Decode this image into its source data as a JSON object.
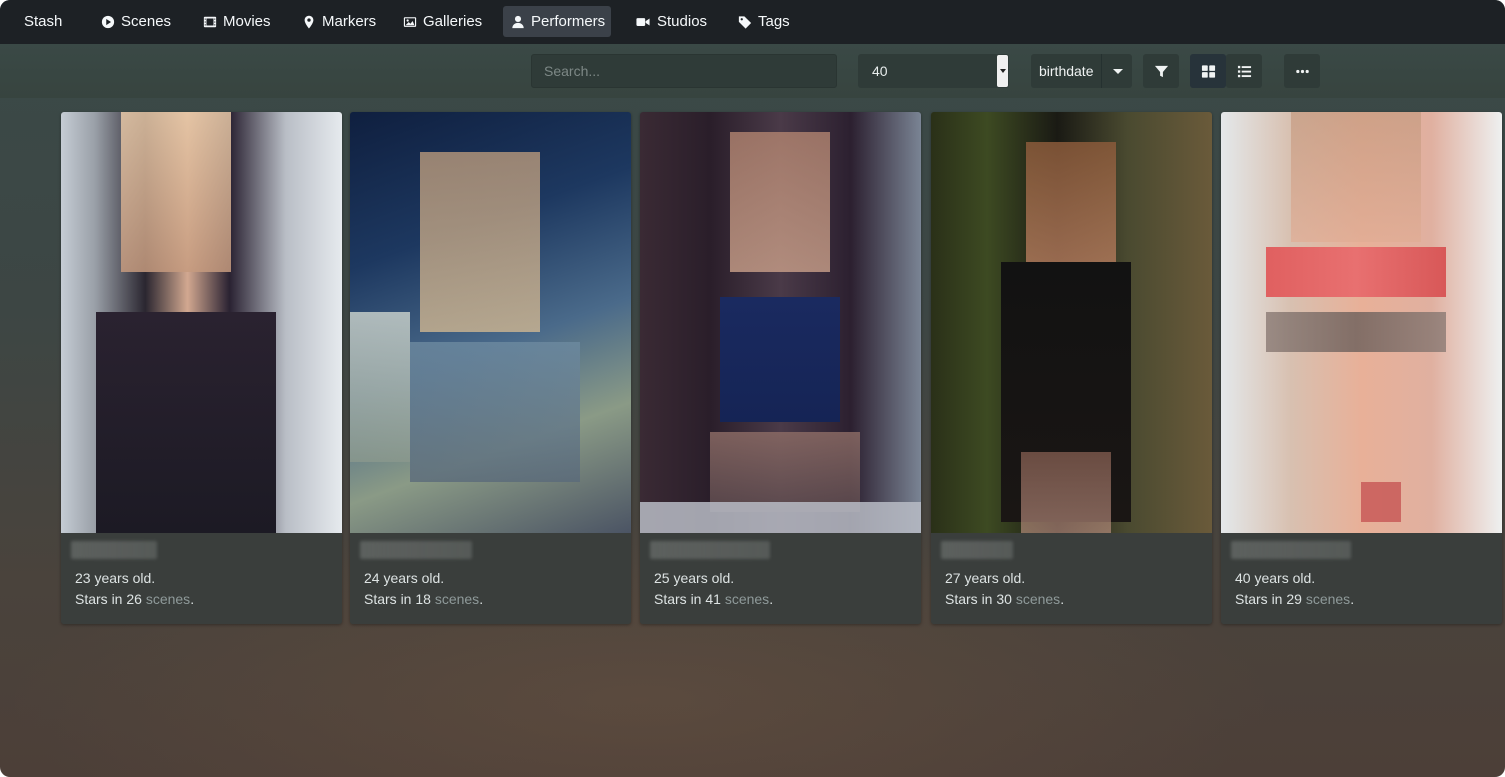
{
  "app": {
    "brand": "Stash"
  },
  "nav": {
    "items": [
      {
        "label": "Scenes",
        "icon": "play-circle-icon",
        "active": false
      },
      {
        "label": "Movies",
        "icon": "film-icon",
        "active": false
      },
      {
        "label": "Markers",
        "icon": "map-marker-icon",
        "active": false
      },
      {
        "label": "Galleries",
        "icon": "image-icon",
        "active": false
      },
      {
        "label": "Performers",
        "icon": "user-icon",
        "active": true
      },
      {
        "label": "Studios",
        "icon": "video-camera-icon",
        "active": false
      },
      {
        "label": "Tags",
        "icon": "tag-icon",
        "active": false
      }
    ]
  },
  "toolbar": {
    "search_placeholder": "Search...",
    "per_page": "40",
    "sort_by": "birthdate",
    "view_mode": "grid"
  },
  "performers": [
    {
      "name": "",
      "age": "23 years old.",
      "stars_prefix": "Stars in",
      "scene_count": "26",
      "scenes_word": "scenes",
      "period": "."
    },
    {
      "name": "",
      "age": "24 years old.",
      "stars_prefix": "Stars in",
      "scene_count": "18",
      "scenes_word": "scenes",
      "period": "."
    },
    {
      "name": "",
      "age": "25 years old.",
      "stars_prefix": "Stars in",
      "scene_count": "41",
      "scenes_word": "scenes",
      "period": "."
    },
    {
      "name": "",
      "age": "27 years old.",
      "stars_prefix": "Stars in",
      "scene_count": "30",
      "scenes_word": "scenes",
      "period": "."
    },
    {
      "name": "",
      "age": "40 years old.",
      "stars_prefix": "Stars in",
      "scene_count": "29",
      "scenes_word": "scenes",
      "period": "."
    }
  ]
}
